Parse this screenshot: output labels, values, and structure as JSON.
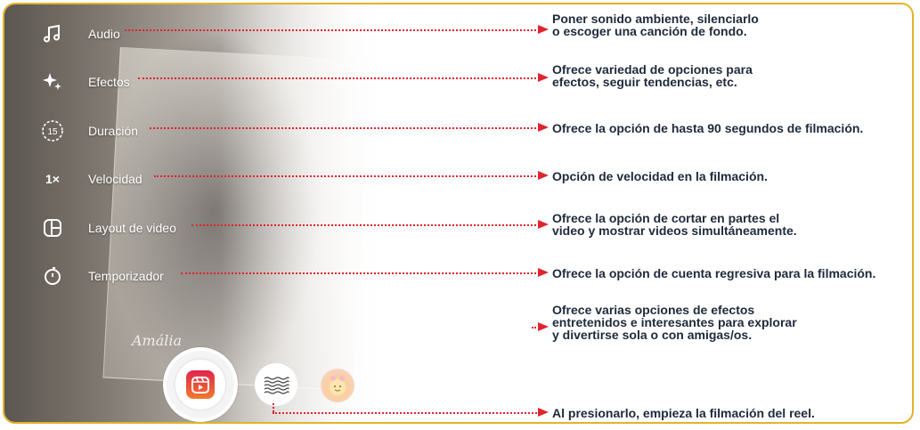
{
  "tools": [
    {
      "id": "audio",
      "icon": "music-note-icon",
      "label": "Audio",
      "description": [
        "Poner sonido ambiente, silenciarlo",
        "o escoger una canción de fondo."
      ]
    },
    {
      "id": "effects",
      "icon": "sparkles-icon",
      "label": "Efectos",
      "description": [
        "Ofrece variedad de opciones para",
        "efectos, seguir tendencias, etc."
      ]
    },
    {
      "id": "duration",
      "icon": "timer-15-icon",
      "icon_text": "15",
      "label": "Duración",
      "description": [
        "Ofrece la opción de hasta 90 segundos de filmación."
      ]
    },
    {
      "id": "speed",
      "icon": "speed-1x-icon",
      "icon_text": "1×",
      "label": "Velocidad",
      "description": [
        "Opción de velocidad en la filmación."
      ]
    },
    {
      "id": "layout",
      "icon": "layout-icon",
      "label": "Layout de video",
      "description": [
        "Ofrece la opción de cortar en partes el",
        "video y mostrar videos simultáneamente."
      ]
    },
    {
      "id": "timer",
      "icon": "countdown-timer-icon",
      "label": "Temporizador",
      "description": [
        "Ofrece la opción de cuenta regresiva para la filmación."
      ]
    }
  ],
  "effects_desc": [
    "Ofrece varias opciones de efectos",
    "entretenidos e interesantes para explorar",
    "y divertirse sola o con amigas/os."
  ],
  "capture_desc": "Al presionarlo, empieza la filmación del reel.",
  "photo_signature": "Amália",
  "colors": {
    "frame": "#e3b22a",
    "arrow": "#e0242f",
    "text": "#1e2a3a",
    "reel_gradient": [
      "#e0244c",
      "#f07a2e"
    ]
  }
}
